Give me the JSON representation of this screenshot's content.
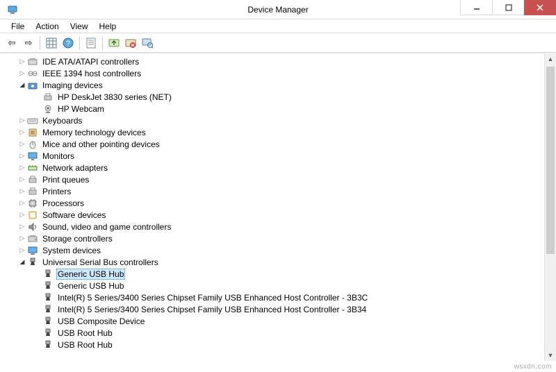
{
  "window": {
    "title": "Device Manager"
  },
  "menu": {
    "file": "File",
    "action": "Action",
    "view": "View",
    "help": "Help"
  },
  "tree": {
    "ide_atapi": "IDE ATA/ATAPI controllers",
    "ieee1394": "IEEE 1394 host controllers",
    "imaging": "Imaging devices",
    "imaging_child_1": "HP DeskJet 3830 series (NET)",
    "imaging_child_2": "HP Webcam",
    "keyboards": "Keyboards",
    "memory_tech": "Memory technology devices",
    "mice": "Mice and other pointing devices",
    "monitors": "Monitors",
    "network": "Network adapters",
    "print_queues": "Print queues",
    "printers": "Printers",
    "processors": "Processors",
    "software_devices": "Software devices",
    "sound_video": "Sound, video and game controllers",
    "storage": "Storage controllers",
    "system_devices": "System devices",
    "usb": "Universal Serial Bus controllers",
    "usb_child_1": "Generic USB Hub",
    "usb_child_2": "Generic USB Hub",
    "usb_child_3": "Intel(R) 5 Series/3400 Series Chipset Family USB Enhanced Host Controller - 3B3C",
    "usb_child_4": "Intel(R) 5 Series/3400 Series Chipset Family USB Enhanced Host Controller - 3B34",
    "usb_child_5": "USB Composite Device",
    "usb_child_6": "USB Root Hub",
    "usb_child_7": "USB Root Hub"
  },
  "watermark": "wsxdn.com"
}
